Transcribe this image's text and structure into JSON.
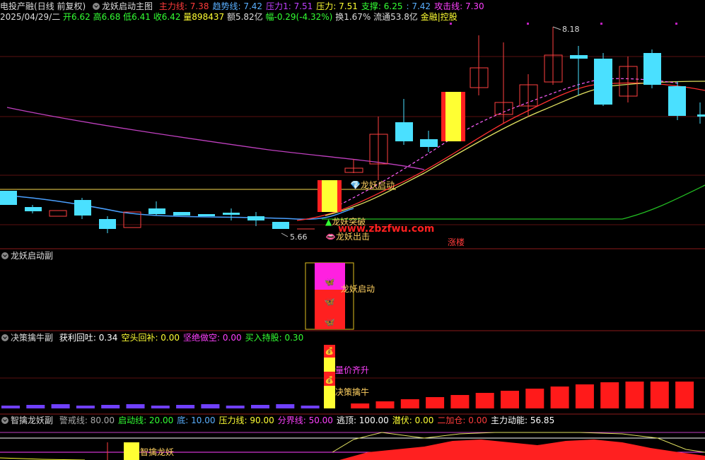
{
  "header": {
    "stock_name": "电投产融",
    "period_label": "(日线 前复权)",
    "indicator_name": "龙妖启动主图",
    "lines": [
      {
        "label": "主力线:",
        "value": "7.38",
        "color": "#ff3b3b"
      },
      {
        "label": "趋势线:",
        "value": "7.42",
        "color": "#5ab0ff"
      },
      {
        "label": "压力1:",
        "value": "7.51",
        "color": "#c040ff"
      },
      {
        "label": "压力:",
        "value": "7.51",
        "color": "#ffff33"
      },
      {
        "label": "支撑:",
        "value": "6.25",
        "color": "#33ff33"
      },
      {
        "label": ":",
        "value": "7.42",
        "color": "#5ab0ff"
      },
      {
        "label": "攻击线:",
        "value": "7.30",
        "color": "#ff40ff"
      }
    ]
  },
  "quote": {
    "date": "2025/04/29/二",
    "open": "开6.62",
    "high": "高6.68",
    "low": "低6.41",
    "close": "收6.42",
    "volume": "量898437",
    "amount": "额5.82亿",
    "change": "幅-0.29(-4.32%)",
    "turnover": "换1.67%",
    "float": "流通53.8亿",
    "tag": "金融|控股"
  },
  "main_chart": {
    "price_high": "8.18",
    "price_low": "5.66",
    "signal_qidong": "龙妖启动",
    "signal_tupo": "龙妖突破",
    "signal_chuji": "龙妖出击",
    "watermark": "www.zbzfwu.com",
    "limit_up_label": "涨楼"
  },
  "panel2": {
    "title": "龙妖启动副",
    "signal": "龙妖启动"
  },
  "panel3": {
    "title": "决策擒牛副",
    "items": [
      {
        "label": "获利回吐:",
        "value": "0.34",
        "color": "#ffffff"
      },
      {
        "label": "空头回补:",
        "value": "0.00",
        "color": "#ffff33"
      },
      {
        "label": "坚绝做空:",
        "value": "0.00",
        "color": "#ff40ff"
      },
      {
        "label": "买入持股:",
        "value": "0.30",
        "color": "#33ff33"
      }
    ],
    "signal_price": "量价齐升",
    "signal_bull": "决策擒牛"
  },
  "panel4": {
    "title": "智擒龙妖副",
    "items": [
      {
        "label": "警戒线:",
        "value": "80.00",
        "color": "#aaaaaa"
      },
      {
        "label": "启动线:",
        "value": "20.00",
        "color": "#33ff33"
      },
      {
        "label": "底:",
        "value": "10.00",
        "color": "#5ab0ff"
      },
      {
        "label": "压力线:",
        "value": "90.00",
        "color": "#ffff33"
      },
      {
        "label": "分界线:",
        "value": "50.00",
        "color": "#ff40ff"
      },
      {
        "label": "逃顶:",
        "value": "100.00",
        "color": "#ffffff"
      },
      {
        "label": "潜伏:",
        "value": "0.00",
        "color": "#ffff33"
      },
      {
        "label": "二加仓:",
        "value": "0.00",
        "color": "#ff3b3b"
      },
      {
        "label": "主力动能:",
        "value": "56.85",
        "color": "#ffffff"
      }
    ],
    "signal": "智擒龙妖"
  }
}
